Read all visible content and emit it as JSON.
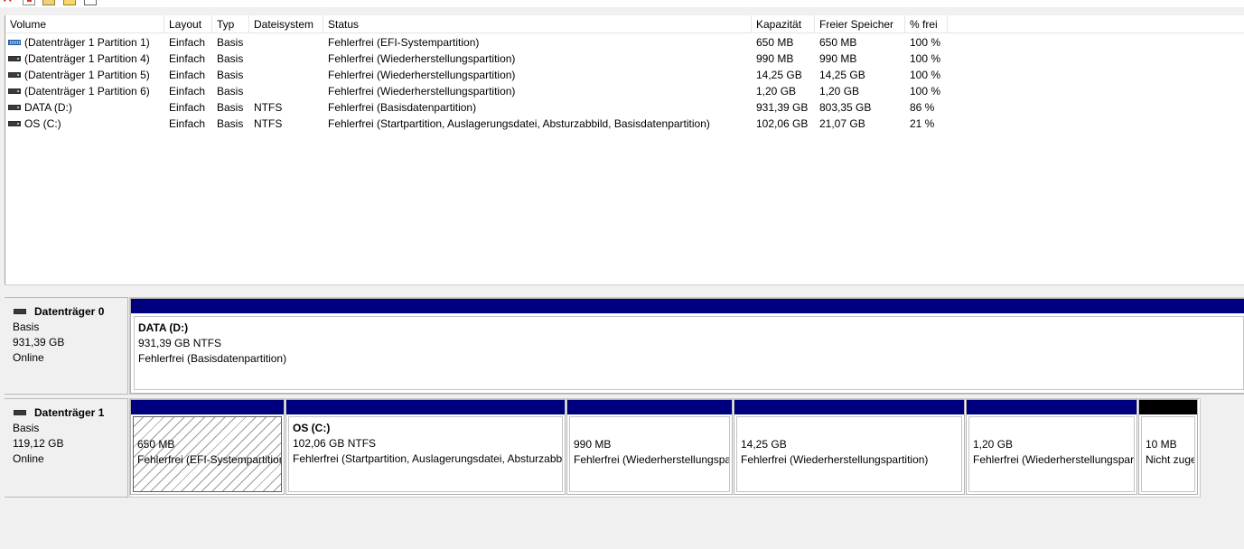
{
  "toolbar": {
    "icons": [
      "delete-icon",
      "properties-icon",
      "help-icon",
      "wizard-icon",
      "console-icon"
    ],
    "colors": {
      "delete": "#d21a1a"
    }
  },
  "listview": {
    "columns": [
      "Volume",
      "Layout",
      "Typ",
      "Dateisystem",
      "Status",
      "Kapazität",
      "Freier Speicher",
      "% frei"
    ],
    "rows": [
      {
        "volume": "(Datenträger 1 Partition 1)",
        "layout": "Einfach",
        "typ": "Basis",
        "fs": "",
        "status": "Fehlerfrei (EFI-Systempartition)",
        "capacity": "650 MB",
        "free": "650 MB",
        "pct": "100 %",
        "icon": "striped"
      },
      {
        "volume": "(Datenträger 1 Partition 4)",
        "layout": "Einfach",
        "typ": "Basis",
        "fs": "",
        "status": "Fehlerfrei (Wiederherstellungspartition)",
        "capacity": "990 MB",
        "free": "990 MB",
        "pct": "100 %",
        "icon": "plain"
      },
      {
        "volume": "(Datenträger 1 Partition 5)",
        "layout": "Einfach",
        "typ": "Basis",
        "fs": "",
        "status": "Fehlerfrei (Wiederherstellungspartition)",
        "capacity": "14,25 GB",
        "free": "14,25 GB",
        "pct": "100 %",
        "icon": "plain"
      },
      {
        "volume": "(Datenträger 1 Partition 6)",
        "layout": "Einfach",
        "typ": "Basis",
        "fs": "",
        "status": "Fehlerfrei (Wiederherstellungspartition)",
        "capacity": "1,20 GB",
        "free": "1,20 GB",
        "pct": "100 %",
        "icon": "plain"
      },
      {
        "volume": "DATA (D:)",
        "layout": "Einfach",
        "typ": "Basis",
        "fs": "NTFS",
        "status": "Fehlerfrei (Basisdatenpartition)",
        "capacity": "931,39 GB",
        "free": "803,35 GB",
        "pct": "86 %",
        "icon": "plain"
      },
      {
        "volume": "OS (C:)",
        "layout": "Einfach",
        "typ": "Basis",
        "fs": "NTFS",
        "status": "Fehlerfrei (Startpartition, Auslagerungsdatei, Absturzabbild, Basisdatenpartition)",
        "capacity": "102,06 GB",
        "free": "21,07 GB",
        "pct": "21 %",
        "icon": "plain"
      }
    ]
  },
  "disks": [
    {
      "name": "Datenträger 0",
      "type": "Basis",
      "size": "931,39 GB",
      "state": "Online",
      "partitions": [
        {
          "title": "DATA  (D:)",
          "line1": "931,39 GB NTFS",
          "line2": "Fehlerfrei (Basisdatenpartition)"
        }
      ]
    },
    {
      "name": "Datenträger 1",
      "type": "Basis",
      "size": "119,12 GB",
      "state": "Online",
      "partitions": [
        {
          "title": "",
          "line1": "650 MB",
          "line2": "Fehlerfrei (EFI-Systempartition)"
        },
        {
          "title": "OS  (C:)",
          "line1": "102,06 GB NTFS",
          "line2": "Fehlerfrei (Startpartition, Auslagerungsdatei, Absturzabbild, Basisdatenpartition)"
        },
        {
          "title": "",
          "line1": "990 MB",
          "line2": "Fehlerfrei (Wiederherstellungspartition)"
        },
        {
          "title": "",
          "line1": "14,25 GB",
          "line2": "Fehlerfrei (Wiederherstellungspartition)"
        },
        {
          "title": "",
          "line1": "1,20 GB",
          "line2": "Fehlerfrei (Wiederherstellungspartition)"
        },
        {
          "title": "",
          "line1": "10 MB",
          "line2": "Nicht zugeordnet"
        }
      ]
    }
  ],
  "colors": {
    "partition_bar": "#00007e",
    "unallocated_bar": "#000000"
  }
}
